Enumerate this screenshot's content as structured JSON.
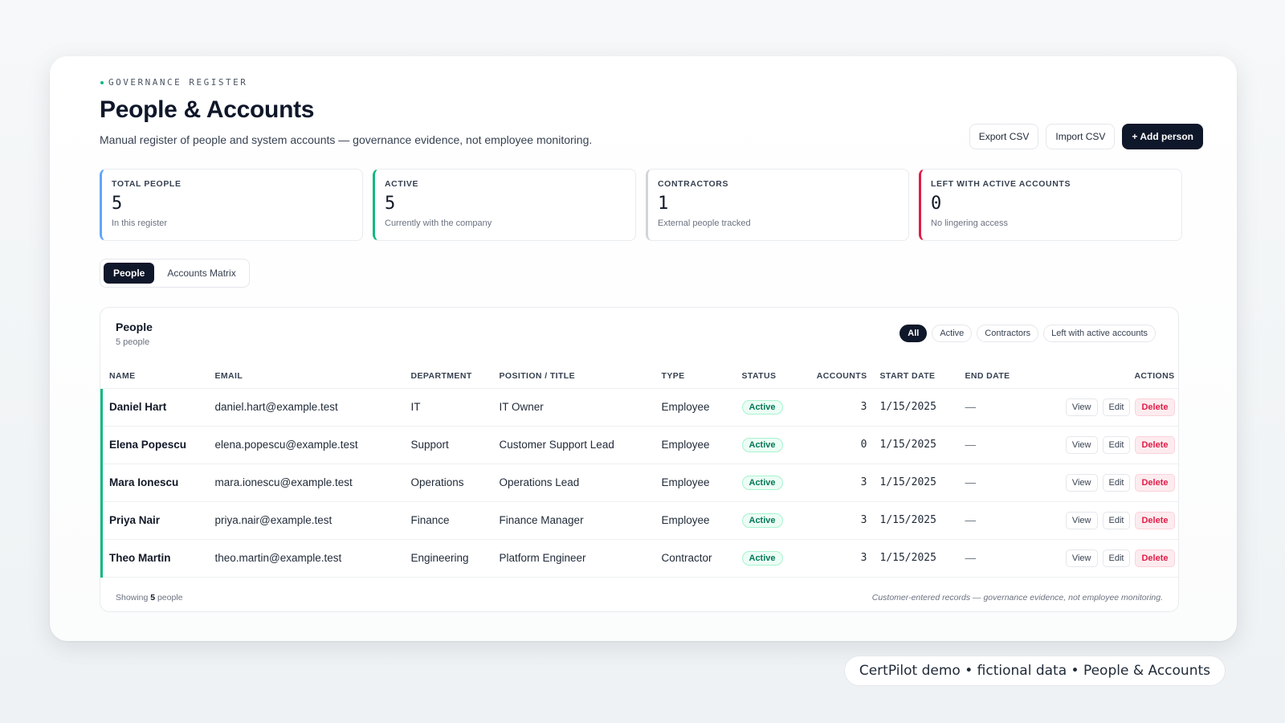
{
  "header": {
    "eyebrow": "GOVERNANCE REGISTER",
    "title": "People & Accounts",
    "subtitle": "Manual register of people and system accounts — governance evidence, not employee monitoring.",
    "actions": {
      "export": "Export CSV",
      "import": "Import CSV",
      "add": "+ Add person"
    }
  },
  "stats": [
    {
      "label": "TOTAL PEOPLE",
      "value": "5",
      "note": "In this register"
    },
    {
      "label": "ACTIVE",
      "value": "5",
      "note": "Currently with the company"
    },
    {
      "label": "CONTRACTORS",
      "value": "1",
      "note": "External people tracked"
    },
    {
      "label": "LEFT WITH ACTIVE ACCOUNTS",
      "value": "0",
      "note": "No lingering access"
    }
  ],
  "tabs": [
    "People",
    "Accounts Matrix"
  ],
  "panel": {
    "title": "People",
    "count": "5 people",
    "filters": [
      "All",
      "Active",
      "Contractors",
      "Left with active accounts"
    ],
    "columns": [
      "NAME",
      "EMAIL",
      "DEPARTMENT",
      "POSITION / TITLE",
      "TYPE",
      "STATUS",
      "ACCOUNTS",
      "START DATE",
      "END DATE",
      "ACTIONS"
    ],
    "rows": [
      {
        "name": "Daniel Hart",
        "email": "daniel.hart@example.test",
        "department": "IT",
        "position": "IT Owner",
        "type": "Employee",
        "status": "Active",
        "accounts": "3",
        "start": "1/15/2025",
        "end": "—"
      },
      {
        "name": "Elena Popescu",
        "email": "elena.popescu@example.test",
        "department": "Support",
        "position": "Customer Support Lead",
        "type": "Employee",
        "status": "Active",
        "accounts": "0",
        "start": "1/15/2025",
        "end": "—"
      },
      {
        "name": "Mara Ionescu",
        "email": "mara.ionescu@example.test",
        "department": "Operations",
        "position": "Operations Lead",
        "type": "Employee",
        "status": "Active",
        "accounts": "3",
        "start": "1/15/2025",
        "end": "—"
      },
      {
        "name": "Priya Nair",
        "email": "priya.nair@example.test",
        "department": "Finance",
        "position": "Finance Manager",
        "type": "Employee",
        "status": "Active",
        "accounts": "3",
        "start": "1/15/2025",
        "end": "—"
      },
      {
        "name": "Theo Martin",
        "email": "theo.martin@example.test",
        "department": "Engineering",
        "position": "Platform Engineer",
        "type": "Contractor",
        "status": "Active",
        "accounts": "3",
        "start": "1/15/2025",
        "end": "—"
      }
    ],
    "row_actions": {
      "view": "View",
      "edit": "Edit",
      "delete": "Delete"
    },
    "footer_prefix": "Showing",
    "footer_count": "5",
    "footer_suffix": "people",
    "footer_note": "Customer-entered records — governance evidence, not employee monitoring."
  },
  "caption": "CertPilot demo • fictional data • People & Accounts",
  "colors": {
    "accent_dark": "#0f172a",
    "active_green": "#10b981",
    "danger_red": "#e11d48",
    "info_blue": "#60a5fa"
  }
}
